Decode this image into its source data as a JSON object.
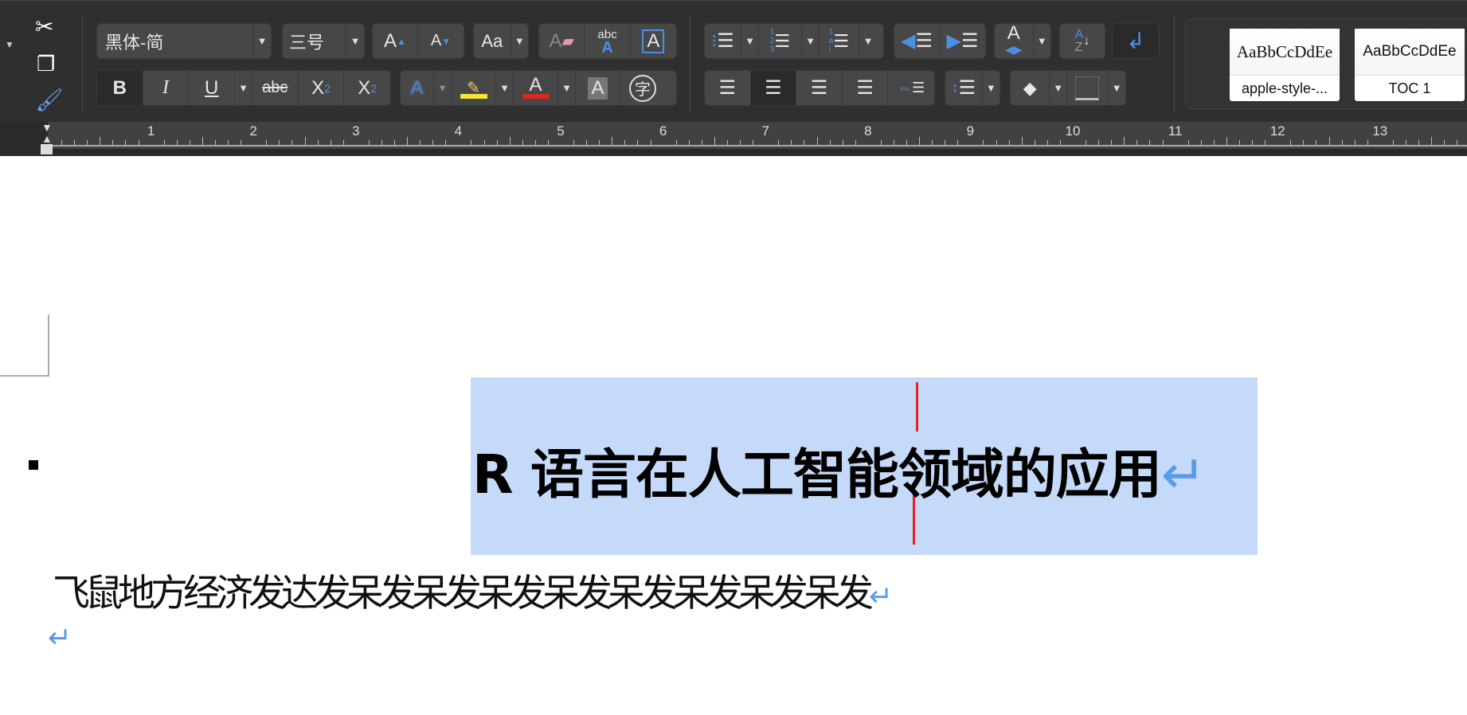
{
  "toolbar": {
    "font_name": "黑体-简",
    "font_size": "三号",
    "grow_font": "A",
    "shrink_font": "A",
    "change_case": "Aa",
    "clear_format": "A",
    "abc": "abc",
    "text_box": "A",
    "bold": "B",
    "italic": "I",
    "underline": "U",
    "strikethrough": "abc",
    "subscript": "X",
    "sub2": "2",
    "superscript": "X",
    "sup2": "2",
    "text_effect": "A",
    "font_color": "A",
    "char_shading": "A",
    "enclose": "字",
    "sort_a": "A",
    "sort_z": "Z"
  },
  "styles": [
    {
      "preview": "AaBbCcDdEe",
      "name": "apple-style-..."
    },
    {
      "preview": "AaBbCcDdEe",
      "name": "TOC 1"
    }
  ],
  "ruler": [
    "1",
    "2",
    "3",
    "4",
    "5",
    "6",
    "7",
    "8",
    "9",
    "10",
    "11",
    "12",
    "13"
  ],
  "document": {
    "title": "R 语言在人工智能领域的应用",
    "body": "飞鼠地方经济发达发呆发呆发呆发呆发呆发呆发呆发呆发",
    "return_mark": "↵"
  },
  "colors": {
    "accent": "#4a90e2",
    "highlight": "#f8e43a",
    "font_color": "#e0261c",
    "selection": "#c5daf9"
  }
}
